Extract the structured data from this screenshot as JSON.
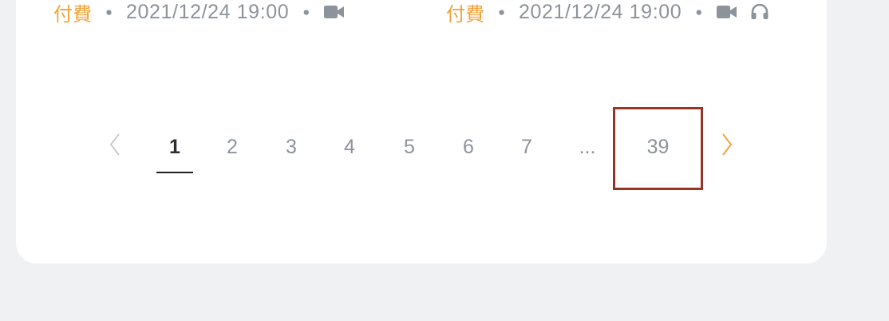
{
  "items": [
    {
      "price_label": "付費",
      "separator": "・",
      "datetime": "2021/12/24 19:00",
      "separator2": "・",
      "icons": [
        "video-camera-icon"
      ]
    },
    {
      "price_label": "付費",
      "separator": "・",
      "datetime": "2021/12/24 19:00",
      "separator2": "・",
      "icons": [
        "video-camera-icon",
        "headphones-icon"
      ]
    }
  ],
  "pagination": {
    "prev_icon": "chevron-left-icon",
    "next_icon": "chevron-right-icon",
    "pages": [
      "1",
      "2",
      "3",
      "4",
      "5",
      "6",
      "7",
      "...",
      "39"
    ],
    "current_page": "1",
    "highlighted_page": "39"
  },
  "colors": {
    "accent": "#f2a33a",
    "text_muted": "#8d939b",
    "text_active": "#2a2d33",
    "highlight_border": "#9a3324",
    "page_background": "#f0f1f3",
    "card_background": "#ffffff"
  }
}
